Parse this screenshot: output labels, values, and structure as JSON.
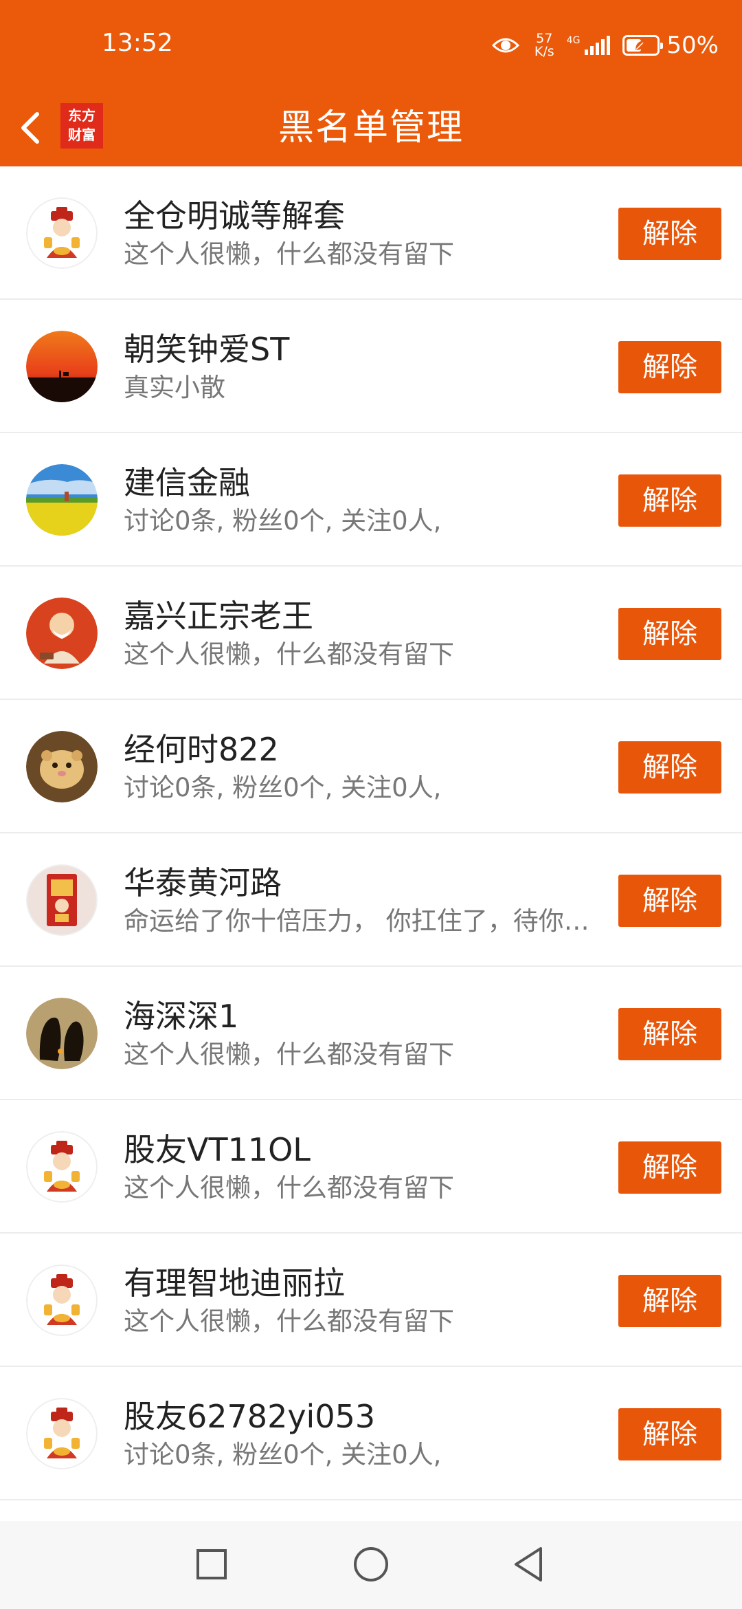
{
  "status_bar": {
    "time": "13:52",
    "net_speed_value": "57",
    "net_speed_unit": "K/s",
    "network_type": "4G",
    "battery_percent": "50%",
    "battery_level": 0.5
  },
  "header": {
    "back_icon": "chevron-left-icon",
    "logo_line1": "东方",
    "logo_line2": "财富",
    "title": "黑名单管理",
    "background_color": "#ea5a0a"
  },
  "blacklist": [
    {
      "name": "全仓明诚等解套",
      "desc": "这个人很懒，什么都没有留下",
      "avatar": "caishen-avatar",
      "button": "解除"
    },
    {
      "name": "朝笑钟爱ST",
      "desc": "真实小散",
      "avatar": "sunset-avatar",
      "button": "解除"
    },
    {
      "name": "建信金融",
      "desc": "讨论0条, 粉丝0个, 关注0人,",
      "avatar": "rapeseed-field-avatar",
      "button": "解除"
    },
    {
      "name": "嘉兴正宗老王",
      "desc": "这个人很懒，什么都没有留下",
      "avatar": "cartoon-grandpa-avatar",
      "button": "解除"
    },
    {
      "name": "经何时822",
      "desc": "讨论0条, 粉丝0个, 关注0人,",
      "avatar": "hamster-avatar",
      "button": "解除"
    },
    {
      "name": "华泰黄河路",
      "desc": "命运给了你十倍压力， 你扛住了，待你…",
      "avatar": "fortune-card-avatar",
      "button": "解除"
    },
    {
      "name": "海深深1",
      "desc": "这个人很懒，什么都没有留下",
      "avatar": "penguins-avatar",
      "button": "解除"
    },
    {
      "name": "股友VT11OL",
      "desc": "这个人很懒，什么都没有留下",
      "avatar": "caishen-avatar",
      "button": "解除"
    },
    {
      "name": "有理智地迪丽拉",
      "desc": "这个人很懒，什么都没有留下",
      "avatar": "caishen-avatar",
      "button": "解除"
    },
    {
      "name": "股友62782yi053",
      "desc": "讨论0条, 粉丝0个, 关注0人,",
      "avatar": "caishen-avatar",
      "button": "解除"
    }
  ],
  "nav_bar": {
    "recents_icon": "square-icon",
    "home_icon": "circle-icon",
    "back_icon": "triangle-back-icon"
  },
  "colors": {
    "accent": "#ea5a0a",
    "button": "#e8560a",
    "name_text": "#222222",
    "desc_text": "#777777"
  }
}
